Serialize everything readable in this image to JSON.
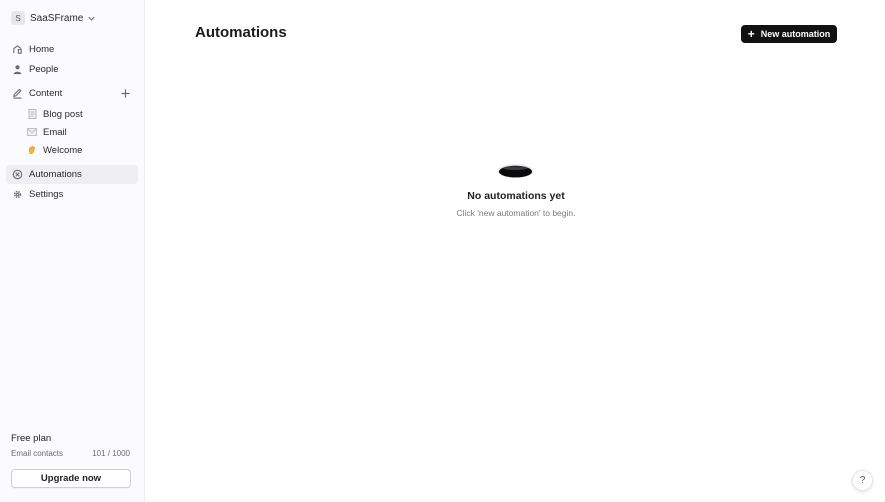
{
  "workspace": {
    "avatar_letter": "S",
    "name": "SaaSFrame"
  },
  "nav": {
    "home": "Home",
    "people": "People",
    "content": "Content",
    "automations": "Automations",
    "settings": "Settings"
  },
  "content_items": [
    {
      "label": "Blog post",
      "icon": "document-icon"
    },
    {
      "label": "Email",
      "icon": "envelope-icon"
    },
    {
      "label": "Welcome",
      "icon": "waving-hand-icon"
    }
  ],
  "plan": {
    "name": "Free plan",
    "contacts_label": "Email contacts",
    "contacts_count": "101 / 1000",
    "upgrade_label": "Upgrade now"
  },
  "main": {
    "title": "Automations",
    "new_button_label": "New automation",
    "empty_title": "No automations yet",
    "empty_subtitle": "Click 'new automation' to begin."
  },
  "help": {
    "label": "?"
  },
  "colors": {
    "accent": "#111113",
    "sidebar_bg": "#fbfafc",
    "active_bg": "#efeef2"
  }
}
